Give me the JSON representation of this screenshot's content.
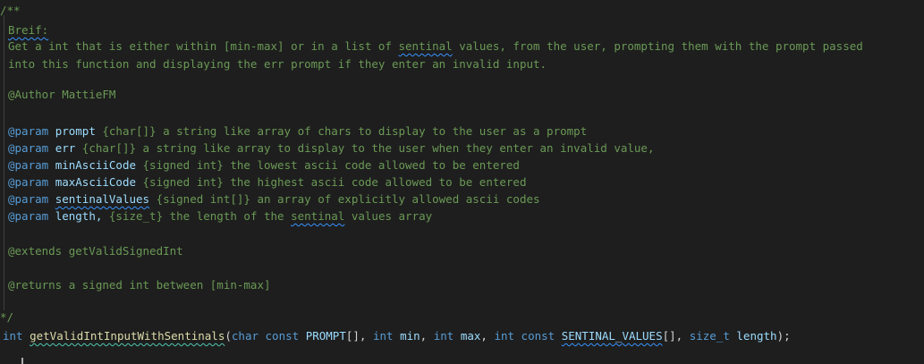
{
  "doc": {
    "open": "/**",
    "brief_tag": "Breif:",
    "desc1": "Get a int that is either within [min-max] or in a list of ",
    "desc1_word": "sentinal",
    "desc1_end": " values, from the user, prompting them with the prompt passed",
    "desc2": "into this function and displaying the err prompt if they enter an invalid input.",
    "author": "@Author MattieFM",
    "params": [
      {
        "tag": "@param",
        "name": "prompt",
        "text": " {char[]} a string like array of chars to display to the user as a prompt"
      },
      {
        "tag": "@param",
        "name": "err",
        "text": " {char[]} a string like array to display to the user when they enter an invalid value,"
      },
      {
        "tag": "@param",
        "name": "minAsciiCode",
        "text": " {signed int} the lowest ascii code allowed to be entered"
      },
      {
        "tag": "@param",
        "name": "maxAsciiCode",
        "text": " {signed int} the highest ascii code allowed to be entered"
      },
      {
        "tag": "@param",
        "name": "sentinalValues",
        "text": " {signed int[]} an array of explicitly allowed ascii codes"
      },
      {
        "tag": "@param",
        "name": "length,",
        "text": " {size_t} the length of the ",
        "word": "sentinal",
        "end": " values array"
      }
    ],
    "extends": "@extends getValidSignedInt",
    "returns": "@returns a signed int between [min-max]",
    "close": "*/"
  },
  "code": {
    "ret_type": "int",
    "fn_name": "getValidIntInputWithSentinals",
    "p1_open": "(",
    "p1_type": "char const",
    "p1_name": "PROMPT",
    "p1_rest": "[], ",
    "p2_type": "int",
    "p2_name": "min",
    "p2_rest": ", ",
    "p3_type": "int",
    "p3_name": "max",
    "p3_rest": ", ",
    "p4_type": "int const",
    "p4_name": "SENTINAL_VALUES",
    "p4_rest": "[], ",
    "p5_type": "size_t",
    "p5_name": "length",
    "close": ");"
  }
}
